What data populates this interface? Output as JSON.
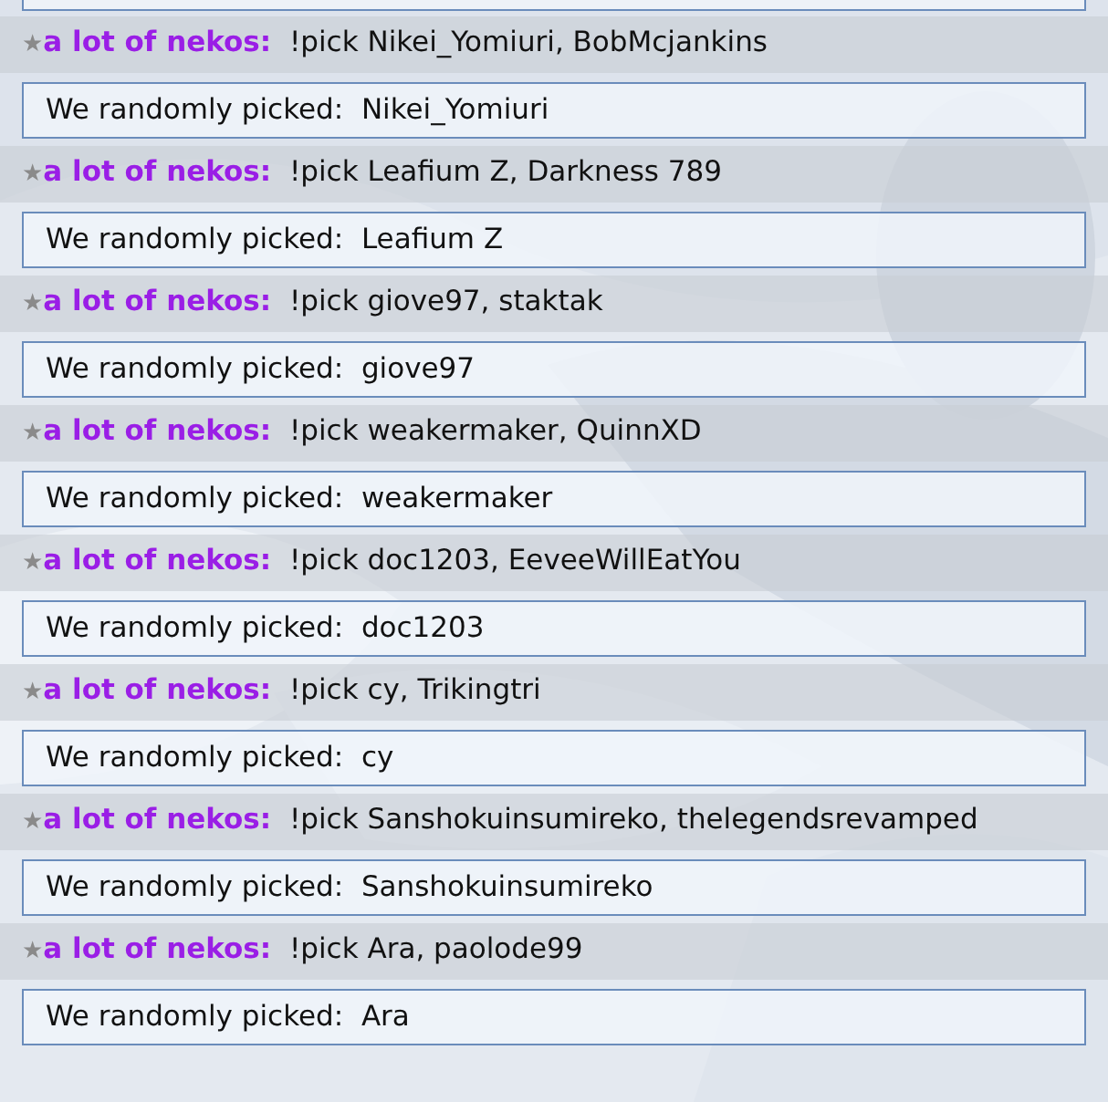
{
  "entries": [
    {
      "rank": "★",
      "user": "a lot of nekos:",
      "message": "!pick Nikei_Yomiuri, BobMcjankins",
      "result": "We randomly picked:  Nikei_Yomiuri"
    },
    {
      "rank": "★",
      "user": "a lot of nekos:",
      "message": "!pick Leafium Z, Darkness 789",
      "result": "We randomly picked:  Leafium Z"
    },
    {
      "rank": "★",
      "user": "a lot of nekos:",
      "message": "!pick giove97, staktak",
      "result": "We randomly picked:  giove97"
    },
    {
      "rank": "★",
      "user": "a lot of nekos:",
      "message": "!pick weakermaker, QuinnXD",
      "result": "We randomly picked:  weakermaker"
    },
    {
      "rank": "★",
      "user": "a lot of nekos:",
      "message": "!pick doc1203, EeveeWillEatYou",
      "result": "We randomly picked:  doc1203"
    },
    {
      "rank": "★",
      "user": "a lot of nekos:",
      "message": "!pick cy, Trikingtri",
      "result": "We randomly picked:  cy"
    },
    {
      "rank": "★",
      "user": "a lot of nekos:",
      "message": "!pick Sanshokuinsumireko, thelegendsrevamped",
      "result": "We randomly picked:  Sanshokuinsumireko"
    },
    {
      "rank": "★",
      "user": "a lot of nekos:",
      "message": "!pick Ara, paolode99",
      "result": "We randomly picked:  Ara"
    }
  ]
}
